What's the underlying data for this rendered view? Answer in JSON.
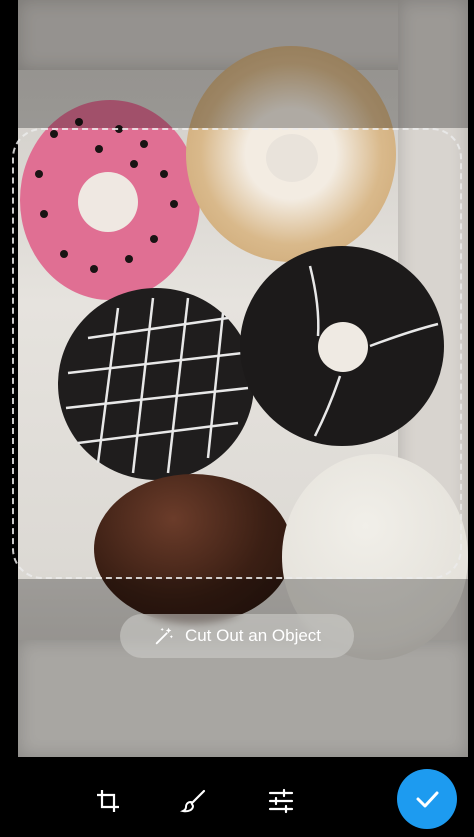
{
  "photo": {
    "description_icon": "donut-box-photo"
  },
  "cutout_button": {
    "label": "Cut Out an Object",
    "icon": "magic-wand-icon"
  },
  "toolbar": {
    "tools": [
      {
        "icon": "crop-icon"
      },
      {
        "icon": "brush-icon"
      },
      {
        "icon": "adjust-sliders-icon"
      }
    ],
    "done_icon": "checkmark-icon"
  },
  "colors": {
    "accent": "#1d9bf0",
    "toolbar_bg": "#000000"
  }
}
